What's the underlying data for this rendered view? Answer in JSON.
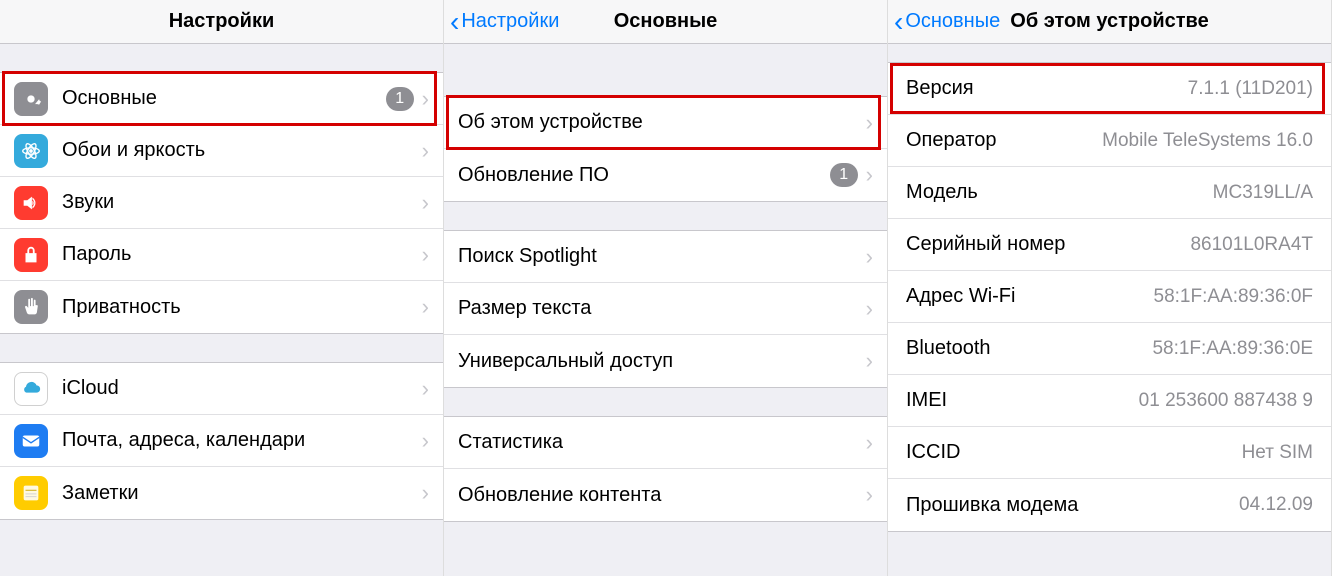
{
  "pane1": {
    "title": "Настройки",
    "groups": [
      {
        "rows": [
          {
            "name": "general",
            "label": "Основные",
            "icon": "gear",
            "iconBg": "#8e8e93",
            "badge": "1",
            "chevron": true,
            "highlight": true
          },
          {
            "name": "wallpaper",
            "label": "Обои и яркость",
            "icon": "atom",
            "iconBg": "#34aadc",
            "chevron": true
          },
          {
            "name": "sounds",
            "label": "Звуки",
            "icon": "speaker",
            "iconBg": "#ff3b30",
            "chevron": true
          },
          {
            "name": "passcode",
            "label": "Пароль",
            "icon": "lock",
            "iconBg": "#ff3b30",
            "chevron": true
          },
          {
            "name": "privacy",
            "label": "Приватность",
            "icon": "hand",
            "iconBg": "#8e8e93",
            "chevron": true
          }
        ]
      },
      {
        "rows": [
          {
            "name": "icloud",
            "label": "iCloud",
            "icon": "cloud",
            "iconBg": "#ffffff",
            "iconBorder": true,
            "chevron": true
          },
          {
            "name": "mail",
            "label": "Почта, адреса, календари",
            "icon": "mail",
            "iconBg": "#1e7cf2",
            "chevron": true
          },
          {
            "name": "notes",
            "label": "Заметки",
            "icon": "notes",
            "iconBg": "#ffcc00",
            "chevron": true
          }
        ]
      }
    ]
  },
  "pane2": {
    "back": "Настройки",
    "title": "Основные",
    "groups": [
      {
        "rows": [
          {
            "name": "about",
            "label": "Об этом устройстве",
            "chevron": true,
            "highlight": true
          },
          {
            "name": "software-update",
            "label": "Обновление ПО",
            "badge": "1",
            "chevron": true
          }
        ]
      },
      {
        "rows": [
          {
            "name": "spotlight",
            "label": "Поиск Spotlight",
            "chevron": true
          },
          {
            "name": "text-size",
            "label": "Размер текста",
            "chevron": true
          },
          {
            "name": "accessibility",
            "label": "Универсальный доступ",
            "chevron": true
          }
        ]
      },
      {
        "rows": [
          {
            "name": "statistics",
            "label": "Статистика",
            "chevron": true
          },
          {
            "name": "content-update",
            "label": "Обновление контента",
            "chevron": true
          }
        ]
      }
    ]
  },
  "pane3": {
    "back": "Основные",
    "title": "Об этом устройстве",
    "rows": [
      {
        "name": "version",
        "label": "Версия",
        "value": "7.1.1 (11D201)",
        "highlight": true
      },
      {
        "name": "carrier",
        "label": "Оператор",
        "value": "Mobile TeleSystems 16.0"
      },
      {
        "name": "model",
        "label": "Модель",
        "value": "MC319LL/A"
      },
      {
        "name": "serial",
        "label": "Серийный номер",
        "value": "86101L0RA4T"
      },
      {
        "name": "wifi",
        "label": "Адрес Wi-Fi",
        "value": "58:1F:AA:89:36:0F"
      },
      {
        "name": "bluetooth",
        "label": "Bluetooth",
        "value": "58:1F:AA:89:36:0E"
      },
      {
        "name": "imei",
        "label": "IMEI",
        "value": "01 253600 887438 9"
      },
      {
        "name": "iccid",
        "label": "ICCID",
        "value": "Нет SIM"
      },
      {
        "name": "modem",
        "label": "Прошивка модема",
        "value": "04.12.09"
      }
    ]
  },
  "icons": {
    "gear": "<path fill='white' d='M12 8a4 4 0 100 8 4 4 0 000-8zm9 4a7 7 0 01-.1 1.2l2 1.6-2 3.4-2.4-.8a7 7 0 01-2 .1.2l-.4 2.5h-4l-.4-2.5a7 7 0 01-2-1.2l-2.4.8-2-3.4 2-1.6a7 7 0 010-2.4l-2-1.6 2-3.4 2.4.8a7 7 0 012-1.2L10 2h4l.4 2.5a7 7 0 012 1.2l2.4-.8 2 3.4-2 1.6c.07.4.1.8.1 1.2z'/>",
    "atom": "<circle cx='12' cy='12' r='2' fill='white'/><ellipse cx='12' cy='12' rx='9' ry='3.5' fill='none' stroke='white' stroke-width='1.5'/><ellipse cx='12' cy='12' rx='9' ry='3.5' fill='none' stroke='white' stroke-width='1.5' transform='rotate(60 12 12)'/><ellipse cx='12' cy='12' rx='9' ry='3.5' fill='none' stroke='white' stroke-width='1.5' transform='rotate(-60 12 12)'/>",
    "speaker": "<path fill='white' d='M4 9v6h4l5 4V5L8 9H4zm11 3a3 3 0 00-1.5-2.6v5.2A3 3 0 0015 12zm-1.5-6v2a5 5 0 010 8v2a7 7 0 000-12z'/>",
    "lock": "<path fill='white' d='M12 3a4 4 0 00-4 4v3H6v10h12V10h-2V7a4 4 0 00-4-4zm-2 7V7a2 2 0 114 0v3h-4z'/>",
    "hand": "<path fill='white' d='M13 2a1 1 0 00-1 1v8h-1V4a1 1 0 10-2 0v9l-1.5-1.8c-.8-.9-2.2-.2-2 1l2 6c.3 1 1.2 1.8 2.3 1.8H16c1.2 0 2.2-.9 2.4-2l1-7c.1-.6-.4-1-.9-1H17V5a1 1 0 10-2 0v6h-1V3a1 1 0 00-1-1z'/>",
    "cloud": "<path fill='#34aadc' d='M18 16a4 4 0 000-8 6 6 0 00-11.5 1.5A3.5 3.5 0 007 16h11z'/>",
    "mail": "<rect x='3' y='6' width='18' height='12' rx='2' fill='white'/><path d='M3 8l9 6 9-6' fill='none' stroke='#1e7cf2' stroke-width='1.5'/>",
    "notes": "<rect x='4' y='4' width='16' height='16' rx='2' fill='#fff9e0'/><line x1='6' y1='9' x2='18' y2='9' stroke='#c9a500' stroke-width='1'/><line x1='6' y1='13' x2='18' y2='13' stroke='#d0d0d0' stroke-width='1'/><line x1='6' y1='16' x2='18' y2='16' stroke='#d0d0d0' stroke-width='1'/>"
  }
}
